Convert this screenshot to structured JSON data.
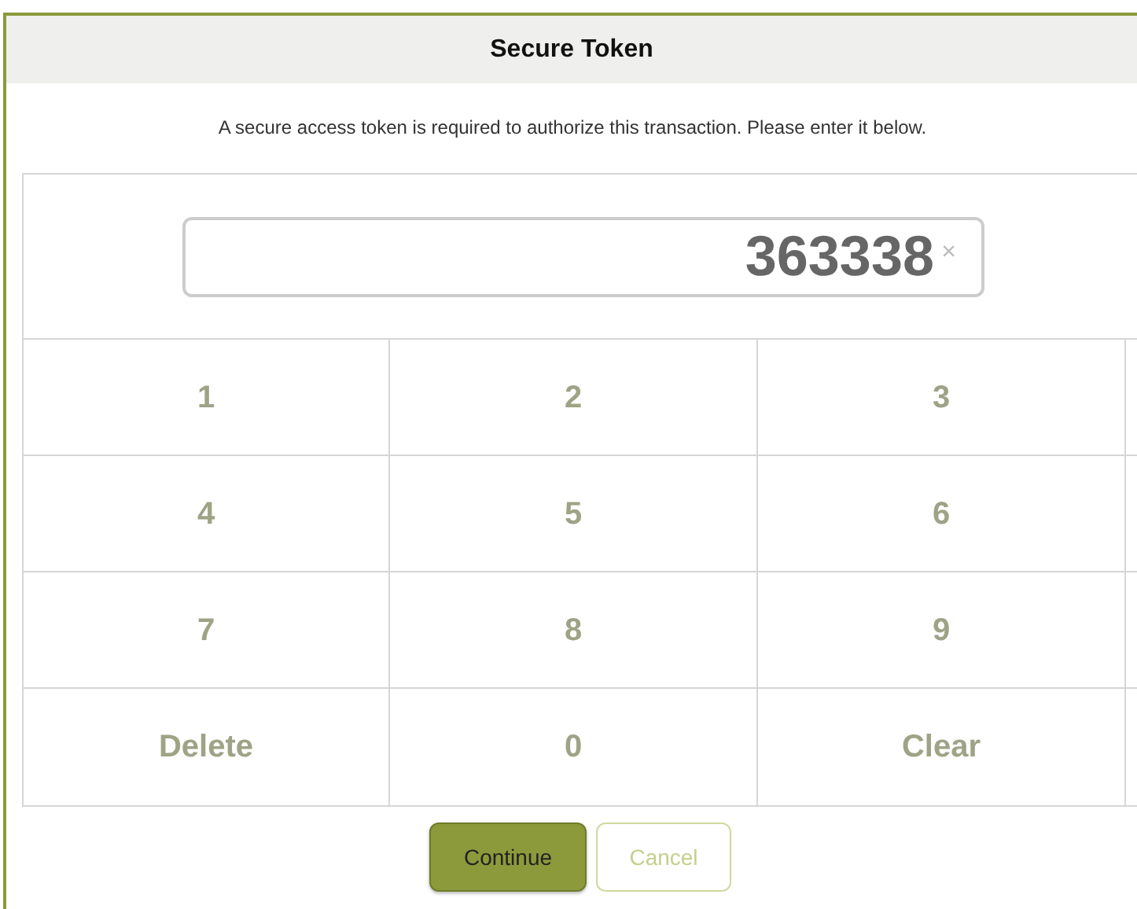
{
  "dialog": {
    "title": "Secure Token",
    "message": "A secure access token is required to authorize this transaction. Please enter it below."
  },
  "token_field": {
    "value": "363338",
    "clear_glyph": "×"
  },
  "keypad": [
    [
      "1",
      "2",
      "3"
    ],
    [
      "4",
      "5",
      "6"
    ],
    [
      "7",
      "8",
      "9"
    ],
    [
      "Delete",
      "0",
      "Clear"
    ]
  ],
  "buttons": [
    {
      "label": "Continue",
      "kind": "primary"
    },
    {
      "label": "Cancel",
      "kind": "secondary"
    }
  ]
}
